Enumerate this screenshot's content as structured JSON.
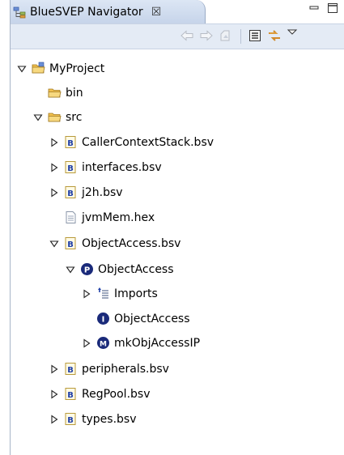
{
  "view": {
    "title": "BlueSVEP Navigator",
    "close_glyph": "☒",
    "minimize_glyph": "▭",
    "maximize_glyph": "◻"
  },
  "toolbar": {
    "back_icon": "back-arrow-icon",
    "forward_icon": "forward-arrow-icon",
    "home_icon": "home-icon",
    "collapse_all_icon": "collapse-all-icon",
    "link_editor_icon": "link-editor-icon",
    "view_menu_icon": "view-menu-icon"
  },
  "tree": [
    {
      "label": "MyProject",
      "icon": "project-folder-icon",
      "twisty": "expanded"
    },
    {
      "label": "bin",
      "icon": "folder-icon",
      "twisty": "none"
    },
    {
      "label": "src",
      "icon": "folder-icon",
      "twisty": "expanded"
    },
    {
      "label": "CallerContextStack.bsv",
      "icon": "bsv-file-icon",
      "twisty": "collapsed"
    },
    {
      "label": "interfaces.bsv",
      "icon": "bsv-file-icon",
      "twisty": "collapsed"
    },
    {
      "label": "j2h.bsv",
      "icon": "bsv-file-icon",
      "twisty": "collapsed"
    },
    {
      "label": "jvmMem.hex",
      "icon": "text-file-icon",
      "twisty": "none"
    },
    {
      "label": "ObjectAccess.bsv",
      "icon": "bsv-file-icon",
      "twisty": "expanded"
    },
    {
      "label": "ObjectAccess",
      "icon": "package-p-icon",
      "twisty": "expanded"
    },
    {
      "label": "Imports",
      "icon": "imports-icon",
      "twisty": "collapsed"
    },
    {
      "label": "ObjectAccess",
      "icon": "interface-i-icon",
      "twisty": "none"
    },
    {
      "label": "mkObjAccessIP",
      "icon": "module-m-icon",
      "twisty": "collapsed"
    },
    {
      "label": "peripherals.bsv",
      "icon": "bsv-file-icon",
      "twisty": "collapsed"
    },
    {
      "label": "RegPool.bsv",
      "icon": "bsv-file-icon",
      "twisty": "collapsed"
    },
    {
      "label": "types.bsv",
      "icon": "bsv-file-icon",
      "twisty": "collapsed"
    }
  ],
  "colors": {
    "tab_bg": "#c6d4ea",
    "toolbar_bg": "#e4ebf5",
    "folder": "#f2c14e",
    "bsv_blue": "#1f3fa8",
    "element_navy": "#1a2a7a"
  }
}
